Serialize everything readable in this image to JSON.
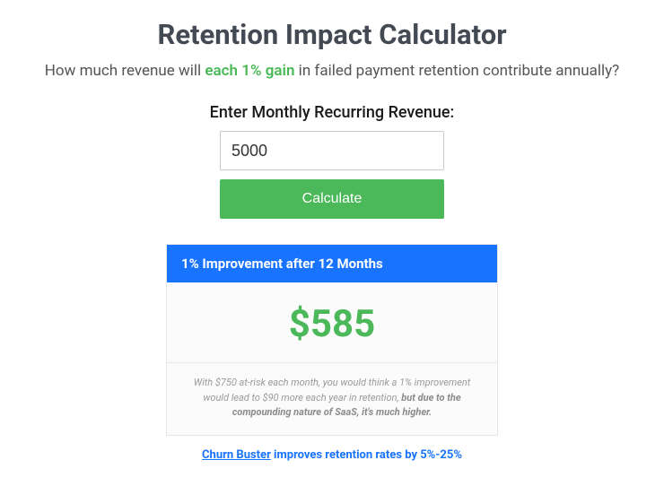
{
  "title": "Retention Impact Calculator",
  "subtitle": {
    "pre": "How much revenue will ",
    "highlight": "each 1% gain",
    "post": " in failed payment retention contribute annually?"
  },
  "form": {
    "label": "Enter Monthly Recurring Revenue:",
    "input_value": "5000",
    "button_label": "Calculate"
  },
  "result": {
    "header": "1% Improvement after 12 Months",
    "amount": "$585",
    "note_pre": "With $750 at-risk each month, you would think a 1% improvement would lead to $90 more each year in retention, ",
    "note_bold": "but due to the compounding nature of SaaS, it's much higher.",
    "note_post": ""
  },
  "footer": {
    "link_text": "Churn Buster",
    "tail": " improves retention rates by 5%-25%"
  }
}
